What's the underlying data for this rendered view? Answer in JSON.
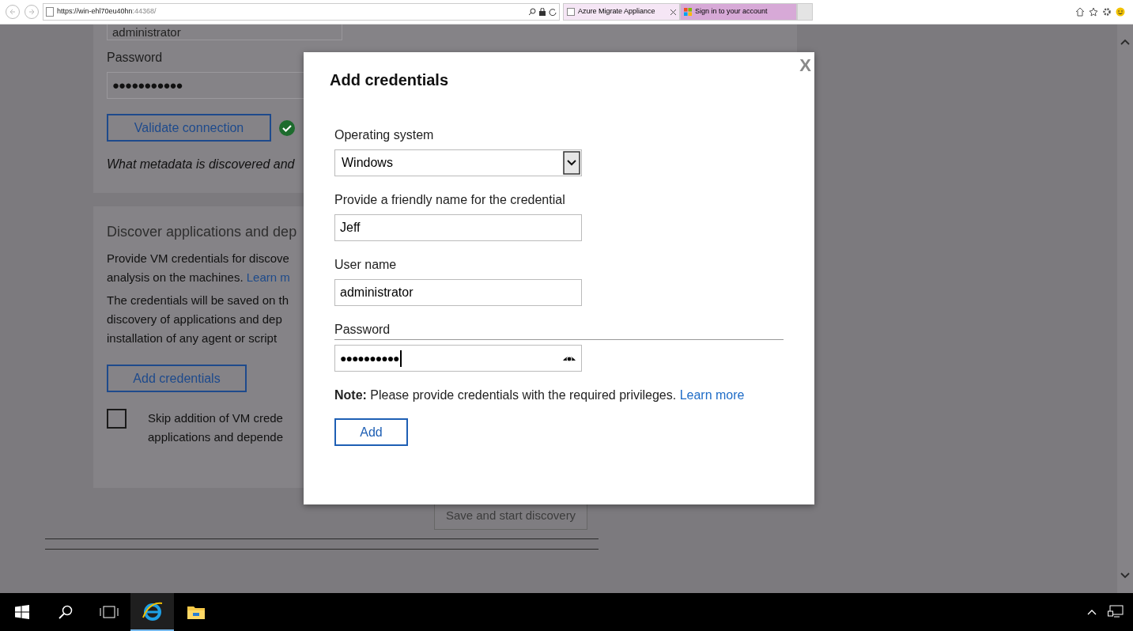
{
  "browser": {
    "address": {
      "url": "https://win-ehl70eu40hn",
      "port": ":44368/"
    },
    "tabs": [
      {
        "title": "Azure Migrate Appliance",
        "selected": true
      },
      {
        "title": "Sign in to your account",
        "selected": false
      }
    ]
  },
  "page": {
    "username_value": "administrator",
    "password_label": "Password",
    "password_value": "●●●●●●●●●●●",
    "validate_button": "Validate connection",
    "validated": true,
    "metadata_text": "What metadata is discovered and",
    "section_title": "Discover applications and dep",
    "paragraph_lines": [
      {
        "text": "Provide VM credentials for discove"
      },
      {
        "text": "analysis on the machines. ",
        "link": "Learn m"
      },
      {
        "text": "The credentials will be saved on th"
      },
      {
        "text": "discovery of applications and dep"
      },
      {
        "text": "installation of any agent or script"
      }
    ],
    "add_credentials_button": "Add credentials",
    "skip": {
      "checked": false,
      "lines": [
        "Skip addition of VM crede",
        "applications and depende"
      ]
    },
    "save_button": {
      "label": "Save and start discovery",
      "disabled": true
    }
  },
  "dialog": {
    "title": "Add credentials",
    "close": "X",
    "fields": [
      {
        "kind": "select",
        "label": "Operating system",
        "value": "Windows"
      },
      {
        "kind": "text",
        "label": "Provide a friendly name for the credential",
        "value": "Jeff"
      },
      {
        "kind": "text",
        "label": "User name",
        "value": "administrator"
      },
      {
        "kind": "password",
        "label": "Password",
        "value": "●●●●●●●●●●"
      }
    ],
    "note": {
      "text": "**Note:** Please provide credentials with the required privileges.",
      "link": "Learn more"
    },
    "add_button": "Add"
  },
  "taskbar": {
    "apps": [
      {
        "kind": "ie",
        "selected": true
      },
      {
        "kind": "explorer",
        "selected": false
      }
    ]
  }
}
